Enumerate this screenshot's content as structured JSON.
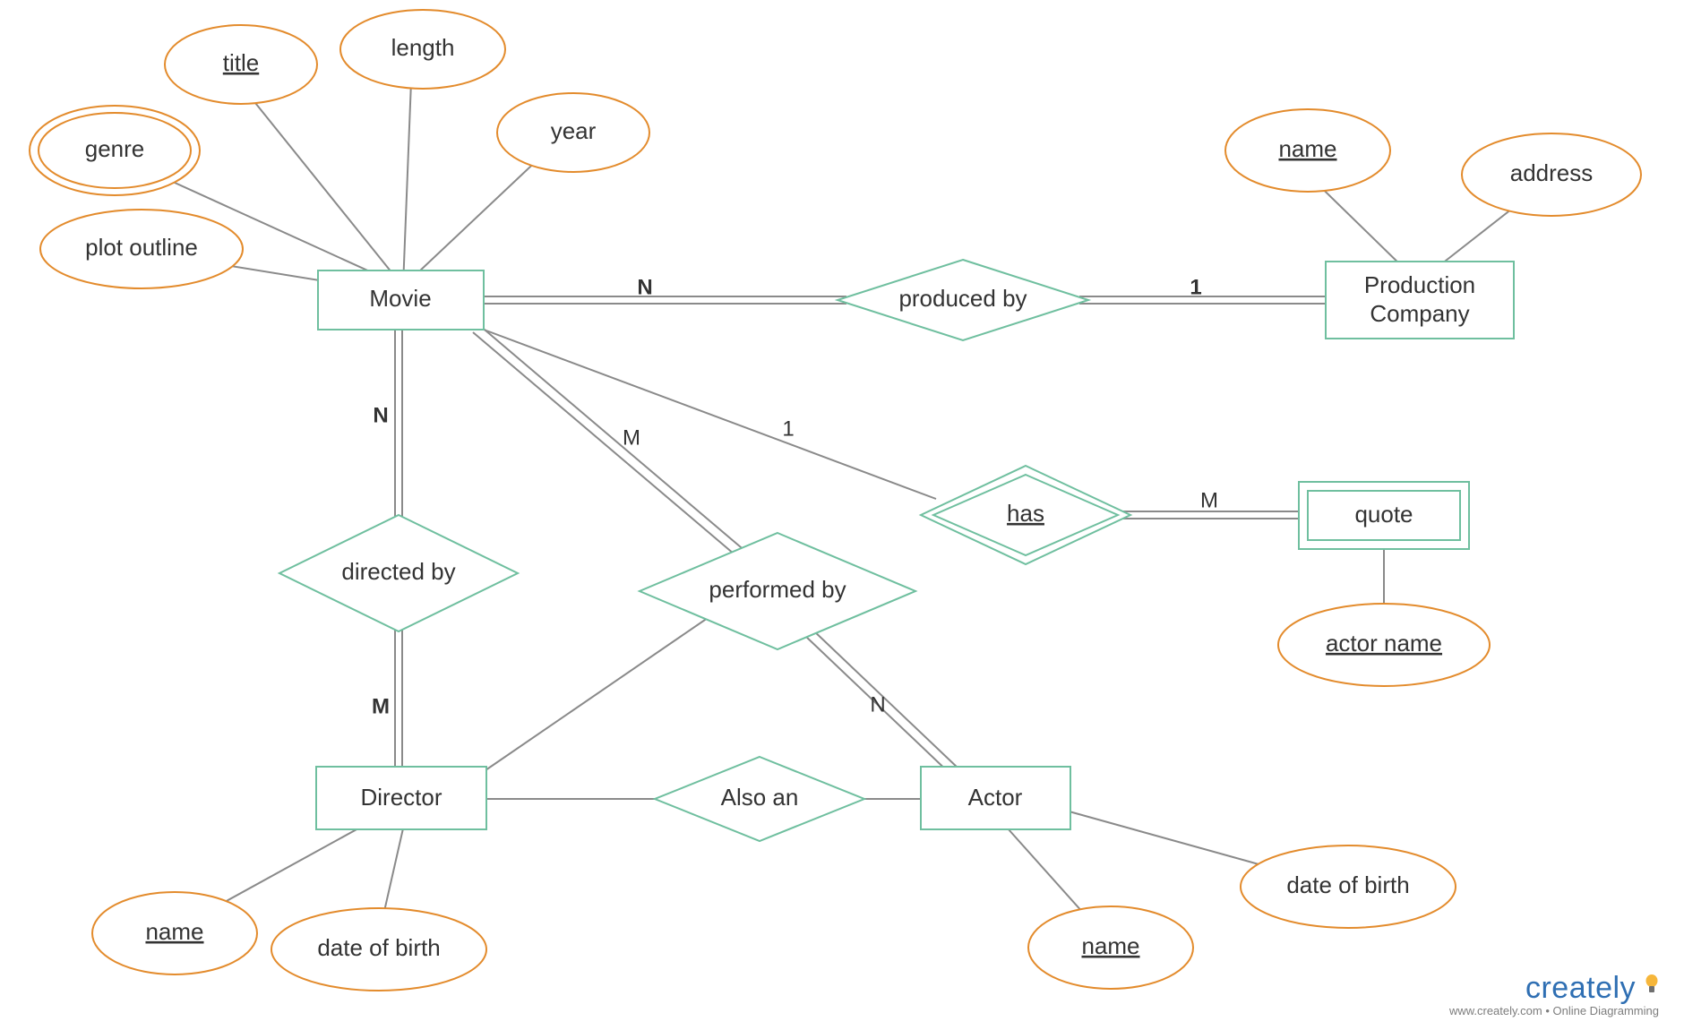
{
  "entities": {
    "movie": "Movie",
    "production_company_line1": "Production",
    "production_company_line2": "Company",
    "director": "Director",
    "actor": "Actor",
    "quote": "quote"
  },
  "attributes": {
    "genre": "genre",
    "title": "title",
    "length": "length",
    "year": "year",
    "plot_outline": "plot outline",
    "pc_name": "name",
    "pc_address": "address",
    "quote_actor_name": "actor name",
    "director_name": "name",
    "director_dob": "date of birth",
    "actor_name": "name",
    "actor_dob": "date of birth"
  },
  "relationships": {
    "produced_by": "produced by",
    "directed_by": "directed by",
    "performed_by": "performed by",
    "has": "has",
    "also_an": "Also an"
  },
  "cardinalities": {
    "movie_produced_N": "N",
    "pc_produced_1": "1",
    "movie_directed_N": "N",
    "director_directed_M": "M",
    "movie_performed_M": "M",
    "actor_performed_N": "N",
    "movie_has_1": "1",
    "quote_has_M": "M"
  },
  "watermark": {
    "brand_main": "create",
    "brand_tail": "ly",
    "sub": "www.creately.com • Online Diagramming"
  }
}
